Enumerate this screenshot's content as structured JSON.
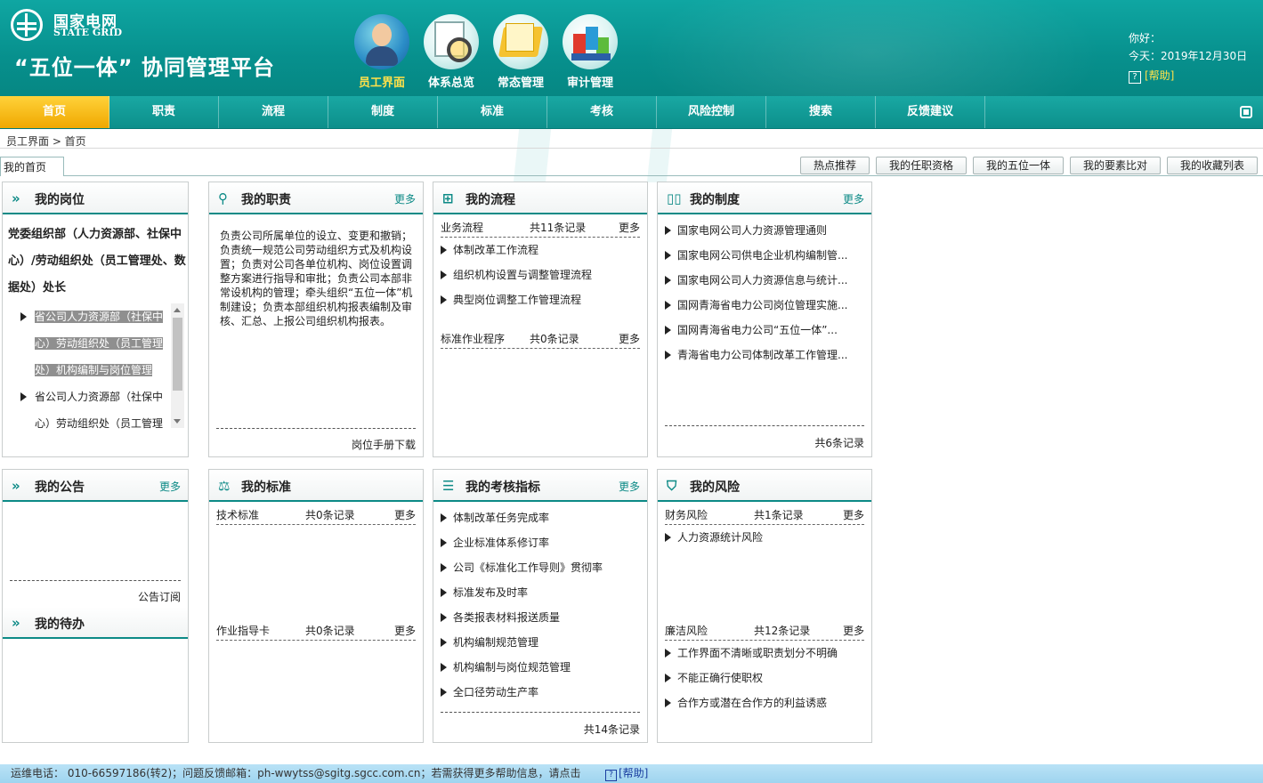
{
  "header": {
    "brand_cn": "国家电网",
    "brand_en": "STATE GRID",
    "platform_title": "“五位一体” 协同管理平台",
    "icons": [
      {
        "label": "员工界面",
        "icon": "employee-avatar-icon",
        "active": true
      },
      {
        "label": "体系总览",
        "icon": "system-overview-icon",
        "active": false
      },
      {
        "label": "常态管理",
        "icon": "folder-icon",
        "active": false
      },
      {
        "label": "审计管理",
        "icon": "audit-chart-icon",
        "active": false
      }
    ],
    "greeting": "你好：",
    "today": "今天：2019年12月30日",
    "help": "[帮助]"
  },
  "nav": {
    "items": [
      "首页",
      "职责",
      "流程",
      "制度",
      "标准",
      "考核",
      "风险控制",
      "搜索",
      "反馈建议"
    ],
    "active_index": 0
  },
  "breadcrumb": "员工界面 > 首页",
  "tabs": {
    "home": "我的首页",
    "buttons": [
      "热点推荐",
      "我的任职资格",
      "我的五位一体",
      "我的要素比对",
      "我的收藏列表"
    ]
  },
  "panels": {
    "post": {
      "title": "我的岗位",
      "post_name": "党委组织部（人力资源部、社保中心）/劳动组织处（员工管理处、数据处）处长",
      "items": [
        "省公司人力资源部（社保中心）劳动组织处（员工管理处）机构编制与岗位管理",
        "省公司人力资源部（社保中心）劳动组织处（员工管理处）"
      ]
    },
    "duty": {
      "title": "我的职责",
      "more": "更多",
      "text": "负责公司所属单位的设立、变更和撤销；负责统一规范公司劳动组织方式及机构设置；负责对公司各单位机构、岗位设置调整方案进行指导和审批；负责公司本部非常设机构的管理；牵头组织“五位一体”机制建设；负责本部组织机构报表编制及审核、汇总、上报公司组织机构报表。",
      "footer": "岗位手册下载"
    },
    "process": {
      "title": "我的流程",
      "sections": [
        {
          "label": "业务流程",
          "count": "共11条记录",
          "more": "更多",
          "items": [
            "体制改革工作流程",
            "组织机构设置与调整管理流程",
            "典型岗位调整工作管理流程"
          ]
        },
        {
          "label": "标准作业程序",
          "count": "共0条记录",
          "more": "更多",
          "items": []
        }
      ]
    },
    "policy": {
      "title": "我的制度",
      "more": "更多",
      "items": [
        "国家电网公司人力资源管理通则",
        "国家电网公司供电企业机构编制管...",
        "国家电网公司人力资源信息与统计...",
        "国网青海省电力公司岗位管理实施...",
        "国网青海省电力公司“五位一体”...",
        "青海省电力公司体制改革工作管理..."
      ],
      "footer": "共6条记录"
    },
    "notice": {
      "title": "我的公告",
      "more": "更多",
      "footer": "公告订阅"
    },
    "todo": {
      "title": "我的待办"
    },
    "standard": {
      "title": "我的标准",
      "sections": [
        {
          "label": "技术标准",
          "count": "共0条记录",
          "more": "更多"
        },
        {
          "label": "作业指导卡",
          "count": "共0条记录",
          "more": "更多"
        }
      ]
    },
    "kpi": {
      "title": "我的考核指标",
      "more": "更多",
      "items": [
        "体制改革任务完成率",
        "企业标准体系修订率",
        "公司《标准化工作导则》贯彻率",
        "标准发布及时率",
        "各类报表材料报送质量",
        "机构编制规范管理",
        "机构编制与岗位规范管理",
        "全口径劳动生产率"
      ],
      "footer": "共14条记录"
    },
    "risk": {
      "title": "我的风险",
      "sections": [
        {
          "label": "财务风险",
          "count": "共1条记录",
          "more": "更多",
          "items": [
            "人力资源统计风险"
          ]
        },
        {
          "label": "廉洁风险",
          "count": "共12条记录",
          "more": "更多",
          "items": [
            "工作界面不清晰或职责划分不明确",
            "不能正确行使职权",
            "合作方或潜在合作方的利益诱惑"
          ]
        }
      ]
    }
  },
  "footer": {
    "text": "运维电话： 010-66597186(转2)；问题反馈邮箱：ph-wwytss@sgitg.sgcc.com.cn；若需获得更多帮助信息，请点击",
    "help": "[帮助]"
  },
  "colors": {
    "accent": "#0c8a86",
    "active_nav": "#f5b400",
    "highlight_text": "#ffe14a"
  }
}
